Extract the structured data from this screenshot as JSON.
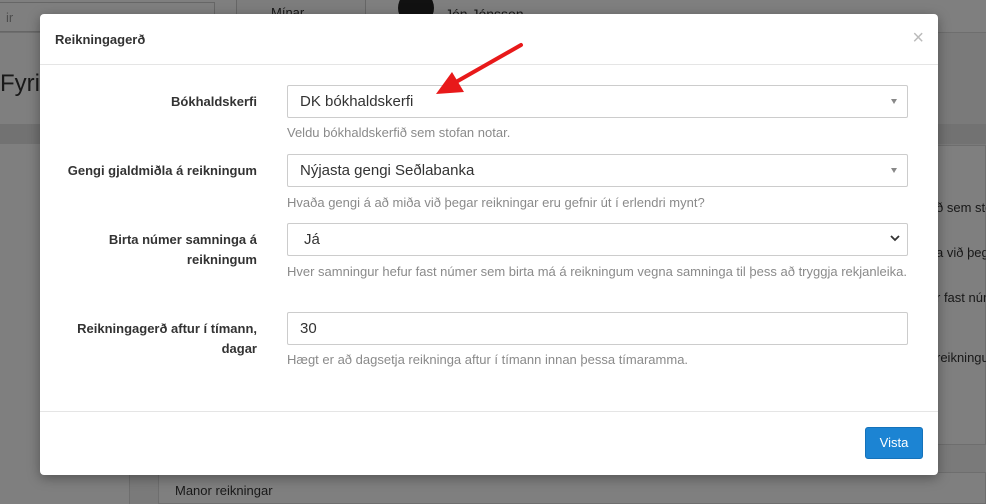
{
  "background": {
    "search_placeholder": "ir",
    "button_label": "Mínar áminningar",
    "user_name": "Jón Jónsson",
    "heading": "Fyrirt",
    "side_texts": [
      "ð sem stofan",
      "a við þegar",
      "r fast númer",
      "reikningum"
    ],
    "bottom_row": "Manor reikningar"
  },
  "modal": {
    "title": "Reikningagerð",
    "close": "×",
    "fields": [
      {
        "label": "Bókhaldskerfi",
        "value": "DK bókhaldskerfi",
        "help": "Veldu bókhaldskerfið sem stofan notar."
      },
      {
        "label": "Gengi gjaldmiðla á reikningum",
        "value": "Nýjasta gengi Seðlabanka",
        "help": "Hvaða gengi á að miða við þegar reikningar eru gefnir út í erlendri mynt?"
      },
      {
        "label": "Birta númer samninga á reikningum",
        "value": "Já",
        "help": "Hver samningur hefur fast númer sem birta má á reikningum vegna samninga til þess að tryggja rekjanleika."
      },
      {
        "label": "Reikningagerð aftur í tímann, dagar",
        "value": "30",
        "help": "Hægt er að dagsetja reikninga aftur í tímann innan þessa tímaramma."
      }
    ],
    "save_label": "Vista"
  },
  "colors": {
    "primary": "#1c84d3",
    "arrow": "#e8191a"
  }
}
